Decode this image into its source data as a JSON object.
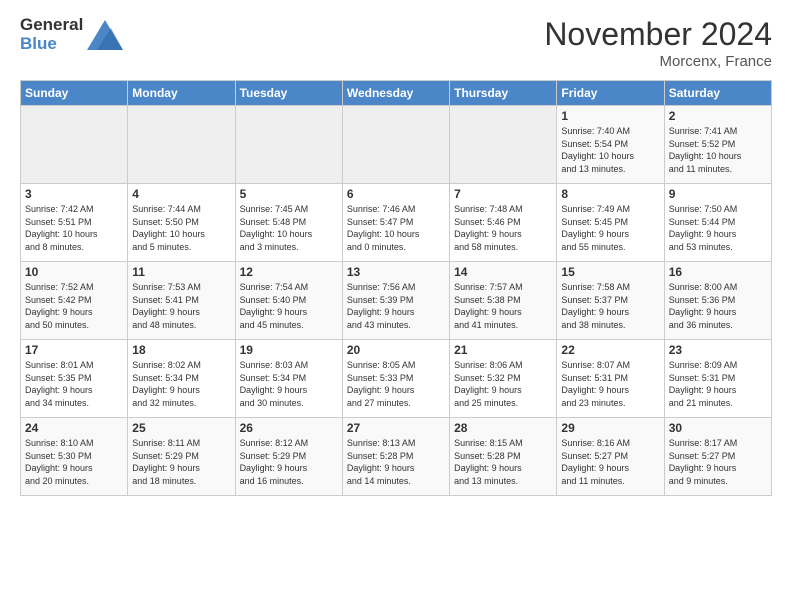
{
  "header": {
    "logo_line1": "General",
    "logo_line2": "Blue",
    "month": "November 2024",
    "location": "Morcenx, France"
  },
  "days_of_week": [
    "Sunday",
    "Monday",
    "Tuesday",
    "Wednesday",
    "Thursday",
    "Friday",
    "Saturday"
  ],
  "weeks": [
    [
      {
        "day": "",
        "info": ""
      },
      {
        "day": "",
        "info": ""
      },
      {
        "day": "",
        "info": ""
      },
      {
        "day": "",
        "info": ""
      },
      {
        "day": "",
        "info": ""
      },
      {
        "day": "1",
        "info": "Sunrise: 7:40 AM\nSunset: 5:54 PM\nDaylight: 10 hours\nand 13 minutes."
      },
      {
        "day": "2",
        "info": "Sunrise: 7:41 AM\nSunset: 5:52 PM\nDaylight: 10 hours\nand 11 minutes."
      }
    ],
    [
      {
        "day": "3",
        "info": "Sunrise: 7:42 AM\nSunset: 5:51 PM\nDaylight: 10 hours\nand 8 minutes."
      },
      {
        "day": "4",
        "info": "Sunrise: 7:44 AM\nSunset: 5:50 PM\nDaylight: 10 hours\nand 5 minutes."
      },
      {
        "day": "5",
        "info": "Sunrise: 7:45 AM\nSunset: 5:48 PM\nDaylight: 10 hours\nand 3 minutes."
      },
      {
        "day": "6",
        "info": "Sunrise: 7:46 AM\nSunset: 5:47 PM\nDaylight: 10 hours\nand 0 minutes."
      },
      {
        "day": "7",
        "info": "Sunrise: 7:48 AM\nSunset: 5:46 PM\nDaylight: 9 hours\nand 58 minutes."
      },
      {
        "day": "8",
        "info": "Sunrise: 7:49 AM\nSunset: 5:45 PM\nDaylight: 9 hours\nand 55 minutes."
      },
      {
        "day": "9",
        "info": "Sunrise: 7:50 AM\nSunset: 5:44 PM\nDaylight: 9 hours\nand 53 minutes."
      }
    ],
    [
      {
        "day": "10",
        "info": "Sunrise: 7:52 AM\nSunset: 5:42 PM\nDaylight: 9 hours\nand 50 minutes."
      },
      {
        "day": "11",
        "info": "Sunrise: 7:53 AM\nSunset: 5:41 PM\nDaylight: 9 hours\nand 48 minutes."
      },
      {
        "day": "12",
        "info": "Sunrise: 7:54 AM\nSunset: 5:40 PM\nDaylight: 9 hours\nand 45 minutes."
      },
      {
        "day": "13",
        "info": "Sunrise: 7:56 AM\nSunset: 5:39 PM\nDaylight: 9 hours\nand 43 minutes."
      },
      {
        "day": "14",
        "info": "Sunrise: 7:57 AM\nSunset: 5:38 PM\nDaylight: 9 hours\nand 41 minutes."
      },
      {
        "day": "15",
        "info": "Sunrise: 7:58 AM\nSunset: 5:37 PM\nDaylight: 9 hours\nand 38 minutes."
      },
      {
        "day": "16",
        "info": "Sunrise: 8:00 AM\nSunset: 5:36 PM\nDaylight: 9 hours\nand 36 minutes."
      }
    ],
    [
      {
        "day": "17",
        "info": "Sunrise: 8:01 AM\nSunset: 5:35 PM\nDaylight: 9 hours\nand 34 minutes."
      },
      {
        "day": "18",
        "info": "Sunrise: 8:02 AM\nSunset: 5:34 PM\nDaylight: 9 hours\nand 32 minutes."
      },
      {
        "day": "19",
        "info": "Sunrise: 8:03 AM\nSunset: 5:34 PM\nDaylight: 9 hours\nand 30 minutes."
      },
      {
        "day": "20",
        "info": "Sunrise: 8:05 AM\nSunset: 5:33 PM\nDaylight: 9 hours\nand 27 minutes."
      },
      {
        "day": "21",
        "info": "Sunrise: 8:06 AM\nSunset: 5:32 PM\nDaylight: 9 hours\nand 25 minutes."
      },
      {
        "day": "22",
        "info": "Sunrise: 8:07 AM\nSunset: 5:31 PM\nDaylight: 9 hours\nand 23 minutes."
      },
      {
        "day": "23",
        "info": "Sunrise: 8:09 AM\nSunset: 5:31 PM\nDaylight: 9 hours\nand 21 minutes."
      }
    ],
    [
      {
        "day": "24",
        "info": "Sunrise: 8:10 AM\nSunset: 5:30 PM\nDaylight: 9 hours\nand 20 minutes."
      },
      {
        "day": "25",
        "info": "Sunrise: 8:11 AM\nSunset: 5:29 PM\nDaylight: 9 hours\nand 18 minutes."
      },
      {
        "day": "26",
        "info": "Sunrise: 8:12 AM\nSunset: 5:29 PM\nDaylight: 9 hours\nand 16 minutes."
      },
      {
        "day": "27",
        "info": "Sunrise: 8:13 AM\nSunset: 5:28 PM\nDaylight: 9 hours\nand 14 minutes."
      },
      {
        "day": "28",
        "info": "Sunrise: 8:15 AM\nSunset: 5:28 PM\nDaylight: 9 hours\nand 13 minutes."
      },
      {
        "day": "29",
        "info": "Sunrise: 8:16 AM\nSunset: 5:27 PM\nDaylight: 9 hours\nand 11 minutes."
      },
      {
        "day": "30",
        "info": "Sunrise: 8:17 AM\nSunset: 5:27 PM\nDaylight: 9 hours\nand 9 minutes."
      }
    ]
  ]
}
